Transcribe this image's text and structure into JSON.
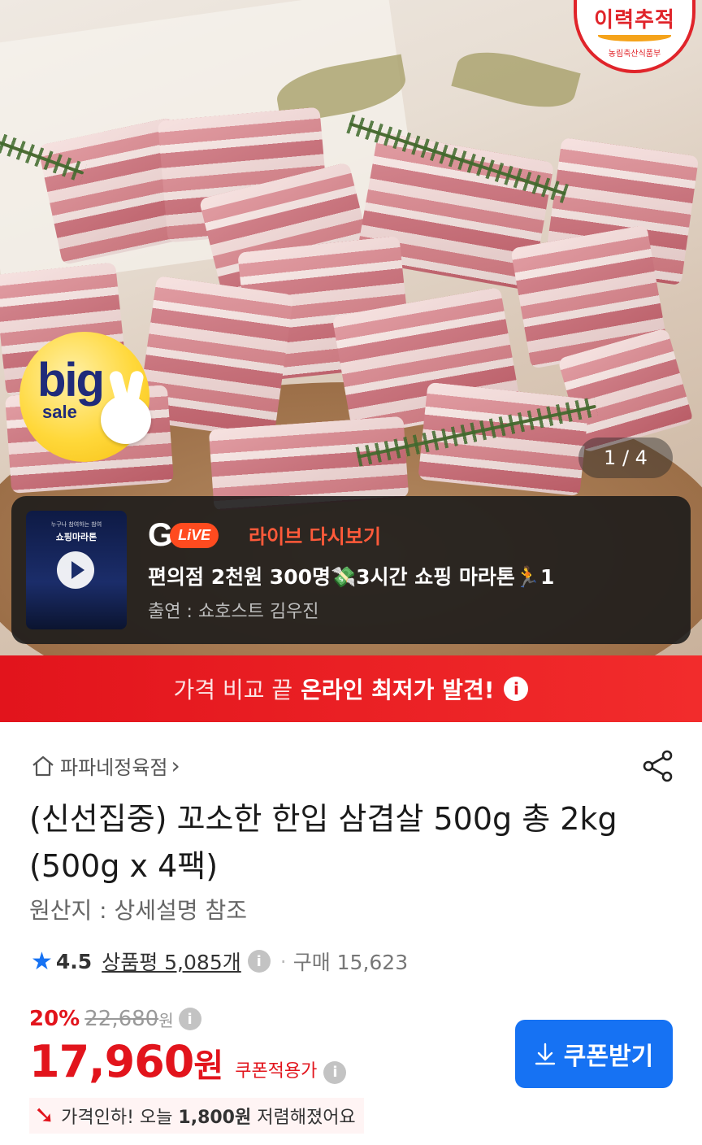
{
  "hero": {
    "image_counter": "1 / 4",
    "big_sale": {
      "big": "big",
      "sale": "sale"
    },
    "corner_badge": {
      "line1": "이력추적",
      "line2": "농림축산식품부"
    }
  },
  "live": {
    "thumb_subtitle": "누구나 참여하는 참여",
    "thumb_title": "쇼핑마라톤",
    "brand_g": "G",
    "brand_live": "LiVE",
    "rerun_label": "라이브 다시보기",
    "title": "편의점 2천원 300명💸3시간 쇼핑 마라톤🏃1",
    "cast": "출연 : 쇼호스트 김우진"
  },
  "banner": {
    "text_regular": "가격 비교 끝",
    "text_bold": "온라인 최저가 발견!",
    "info_icon": "i"
  },
  "product": {
    "store_name": "파파네정육점",
    "store_chevron": "›",
    "title": "(신선집중) 꼬소한 한입 삼겹살 500g 총 2kg (500g x 4팩)",
    "origin": "원산지 : 상세설명 참조",
    "rating": "4.5",
    "reviews_label": "상품평 5,085개",
    "purchase_label": "구매 15,623",
    "discount_rate": "20%",
    "original_price": "22,680",
    "won": "원",
    "price": "17,960",
    "price_label": "쿠폰적용가",
    "coupon_button": "쿠폰받기",
    "price_drop_prefix": "가격인하! 오늘",
    "price_drop_amount": "1,800원",
    "price_drop_suffix": "저렴해졌어요"
  },
  "colors": {
    "accent_red": "#e2141c",
    "accent_blue": "#1672f3",
    "live_orange": "#ff4b1f"
  },
  "icons": [
    "home-icon",
    "share-icon",
    "star-icon",
    "info-icon",
    "download-icon",
    "play-icon",
    "down-arrow-icon"
  ]
}
